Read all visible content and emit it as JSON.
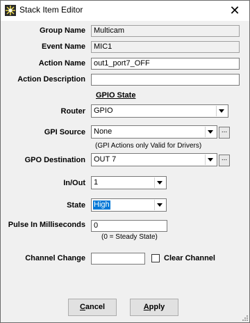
{
  "window": {
    "title": "Stack Item Editor",
    "close_glyph": "✕"
  },
  "fields": {
    "group_name": {
      "label": "Group Name",
      "value": "Multicam"
    },
    "event_name": {
      "label": "Event Name",
      "value": "MIC1"
    },
    "action_name": {
      "label": "Action Name",
      "value": "out1_port7_OFF"
    },
    "action_description": {
      "label": "Action Description",
      "value": ""
    }
  },
  "gpio": {
    "section_title": "GPIO State",
    "router": {
      "label": "Router",
      "value": "GPIO"
    },
    "gpi_source": {
      "label": "GPI Source",
      "value": "None",
      "browse": "...",
      "hint": "(GPI Actions only Valid for Drivers)"
    },
    "gpo_destination": {
      "label": "GPO Destination",
      "value": "OUT 7",
      "browse": "..."
    },
    "in_out": {
      "label": "In/Out",
      "value": "1"
    },
    "state": {
      "label": "State",
      "value": "High"
    },
    "pulse": {
      "label": "Pulse In Milliseconds",
      "value": "0",
      "hint": "(0 = Steady State)"
    }
  },
  "channel": {
    "label": "Channel Change",
    "value": "",
    "clear_label": "Clear Channel",
    "clear_checked": false
  },
  "buttons": {
    "cancel": {
      "label_prefix": "",
      "label_mnemonic": "C",
      "label_rest": "ancel"
    },
    "apply": {
      "label_prefix": "",
      "label_mnemonic": "A",
      "label_rest": "pply"
    }
  },
  "icons": {
    "app": "starburst-icon",
    "close": "close-icon",
    "dropdown": "chevron-down-icon"
  }
}
